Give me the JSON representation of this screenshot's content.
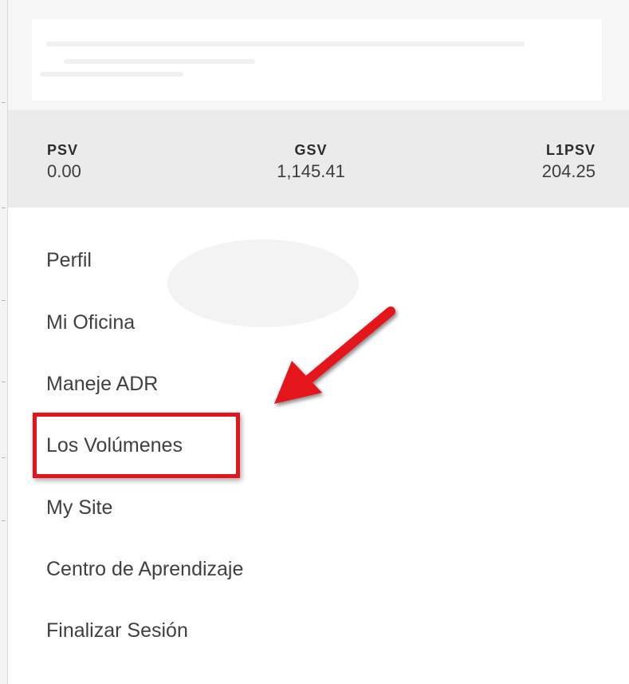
{
  "metrics": [
    {
      "label": "PSV",
      "value": "0.00"
    },
    {
      "label": "GSV",
      "value": "1,145.41"
    },
    {
      "label": "L1PSV",
      "value": "204.25"
    }
  ],
  "menu": {
    "items": [
      {
        "label": "Perfil"
      },
      {
        "label": "Mi Oficina"
      },
      {
        "label": "Maneje ADR"
      },
      {
        "label": "Los Volúmenes"
      },
      {
        "label": "My Site"
      },
      {
        "label": "Centro de Aprendizaje"
      },
      {
        "label": "Finalizar Sesión"
      }
    ],
    "highlighted_item": "Los Volúmenes"
  },
  "annotation": {
    "color": "#e4141b",
    "arrow_icon": "red-arrow-icon"
  }
}
